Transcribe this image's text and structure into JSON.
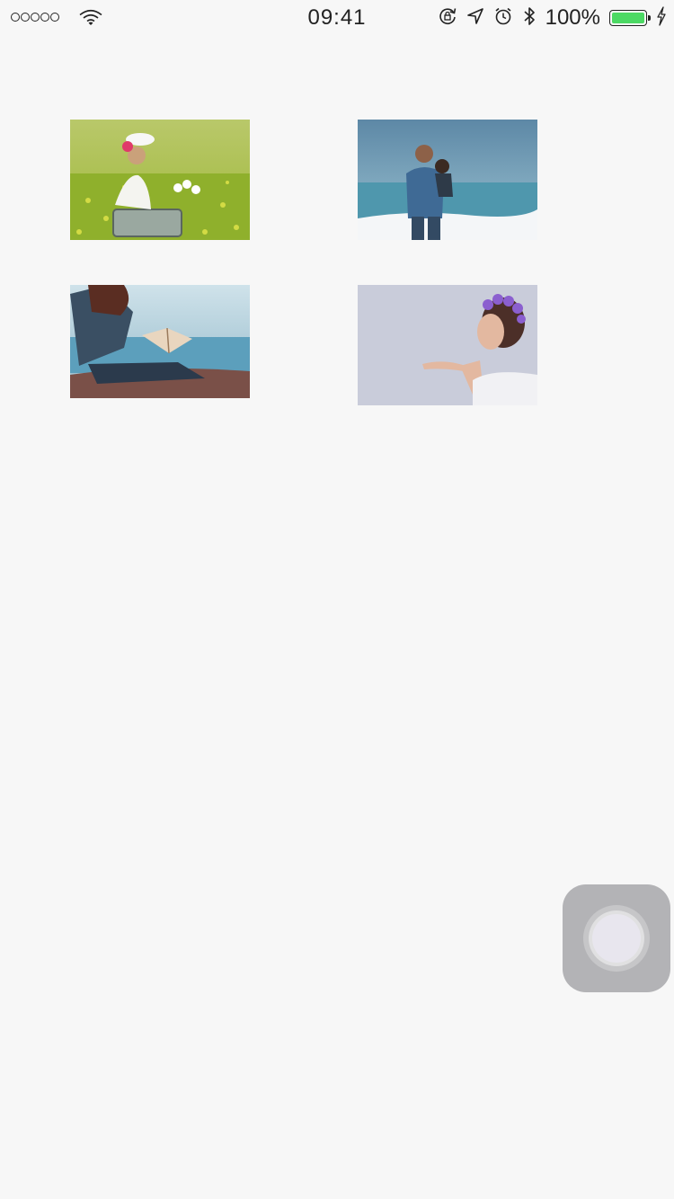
{
  "status_bar": {
    "time": "09:41",
    "battery_percent": "100%",
    "battery_level": 1.0,
    "signal_dots": 5,
    "colors": {
      "battery_fill": "#4cd964",
      "text": "#222222"
    },
    "icons": [
      "signal-dots-icon",
      "wifi-icon",
      "rotation-lock-icon",
      "location-arrow-icon",
      "alarm-clock-icon",
      "bluetooth-icon",
      "battery-icon",
      "charging-bolt-icon"
    ]
  },
  "gallery": {
    "photos": [
      {
        "subject": "girl-in-flower-field"
      },
      {
        "subject": "man-holding-child-at-beach"
      },
      {
        "subject": "person-reading-book-by-lake"
      },
      {
        "subject": "woman-blowing-kiss"
      }
    ]
  },
  "assistive_touch": {
    "icon": "assistive-touch-icon",
    "color": "#b3b3b6"
  },
  "colors": {
    "background": "#f7f7f7"
  }
}
